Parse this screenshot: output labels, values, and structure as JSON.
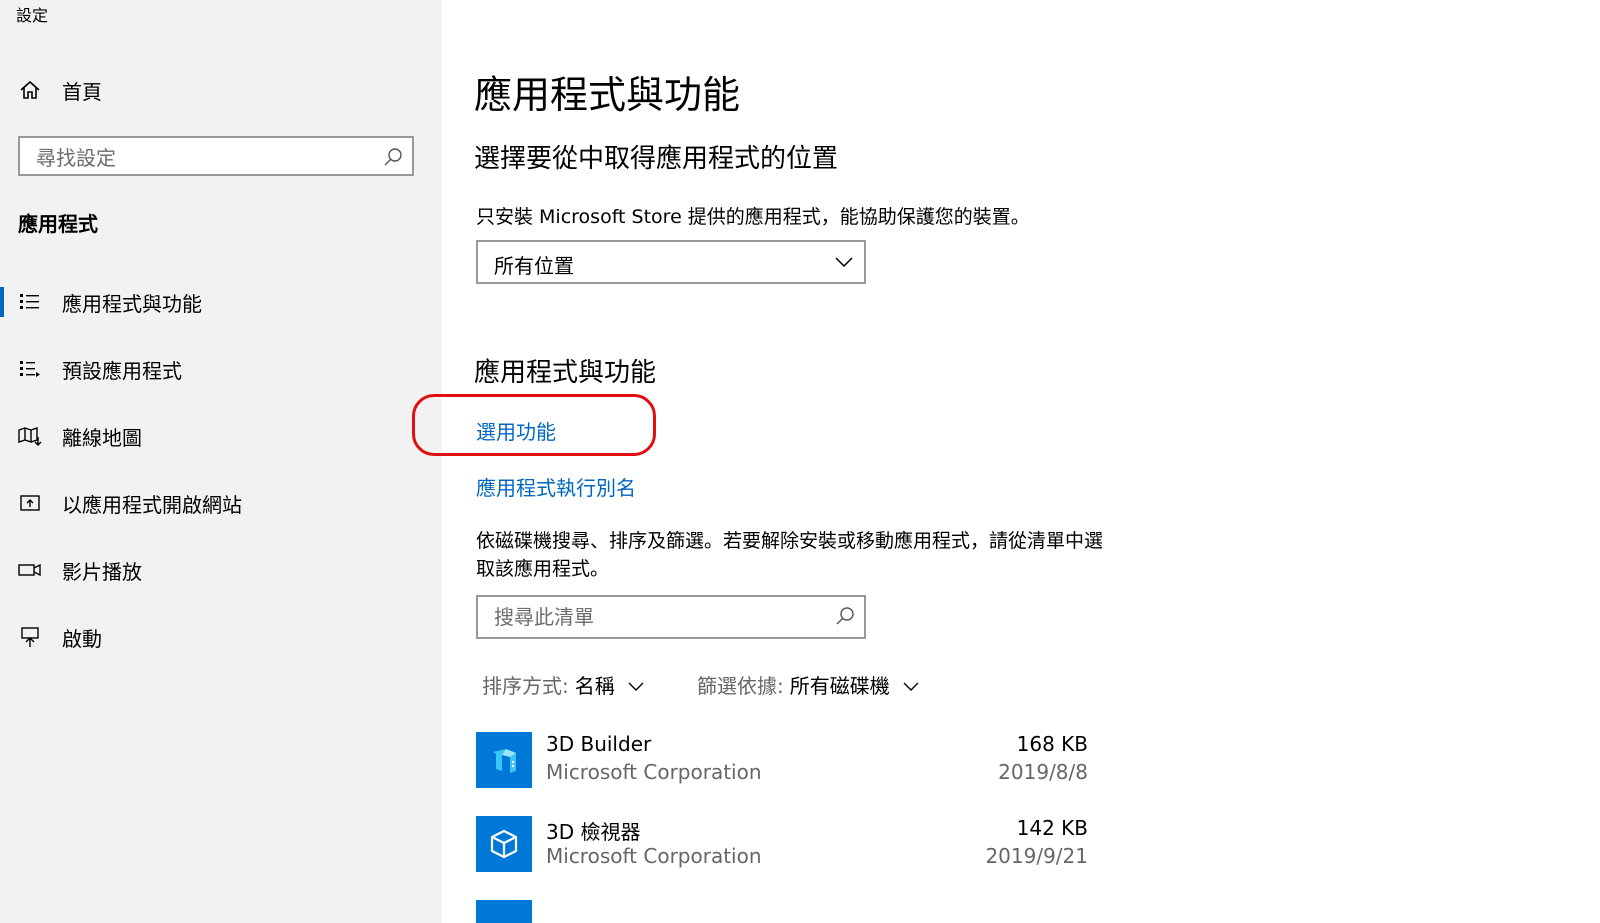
{
  "window": {
    "title": "設定"
  },
  "sidebar": {
    "home_label": "首頁",
    "search_placeholder": "尋找設定",
    "section_title": "應用程式",
    "items": [
      {
        "label": "應用程式與功能",
        "icon": "apps-list-icon",
        "active": true
      },
      {
        "label": "預設應用程式",
        "icon": "default-apps-icon",
        "active": false
      },
      {
        "label": "離線地圖",
        "icon": "map-icon",
        "active": false
      },
      {
        "label": "以應用程式開啟網站",
        "icon": "open-website-icon",
        "active": false
      },
      {
        "label": "影片播放",
        "icon": "video-icon",
        "active": false
      },
      {
        "label": "啟動",
        "icon": "startup-icon",
        "active": false
      }
    ]
  },
  "main": {
    "title": "應用程式與功能",
    "install_source": {
      "heading": "選擇要從中取得應用程式的位置",
      "description": "只安裝 Microsoft Store 提供的應用程式，能協助保護您的裝置。",
      "selected": "所有位置"
    },
    "apps_section": {
      "heading": "應用程式與功能",
      "optional_features_link": "選用功能",
      "aliases_link": "應用程式執行別名",
      "list_description": "依磁碟機搜尋、排序及篩選。若要解除安裝或移動應用程式，請從清單中選取該應用程式。",
      "search_placeholder": "搜尋此清單",
      "sort_label": "排序方式:",
      "sort_value": "名稱",
      "filter_label": "篩選依據:",
      "filter_value": "所有磁碟機"
    },
    "apps": [
      {
        "name": "3D Builder",
        "publisher": "Microsoft Corporation",
        "size": "168 KB",
        "date": "2019/8/8",
        "icon": "3d-builder-icon"
      },
      {
        "name": "3D 檢視器",
        "publisher": "Microsoft Corporation",
        "size": "142 KB",
        "date": "2019/9/21",
        "icon": "3d-viewer-icon"
      }
    ]
  },
  "colors": {
    "accent": "#0067c0",
    "tile": "#0078d7",
    "highlight": "#e01010",
    "sidebar_bg": "#f2f2f2"
  }
}
